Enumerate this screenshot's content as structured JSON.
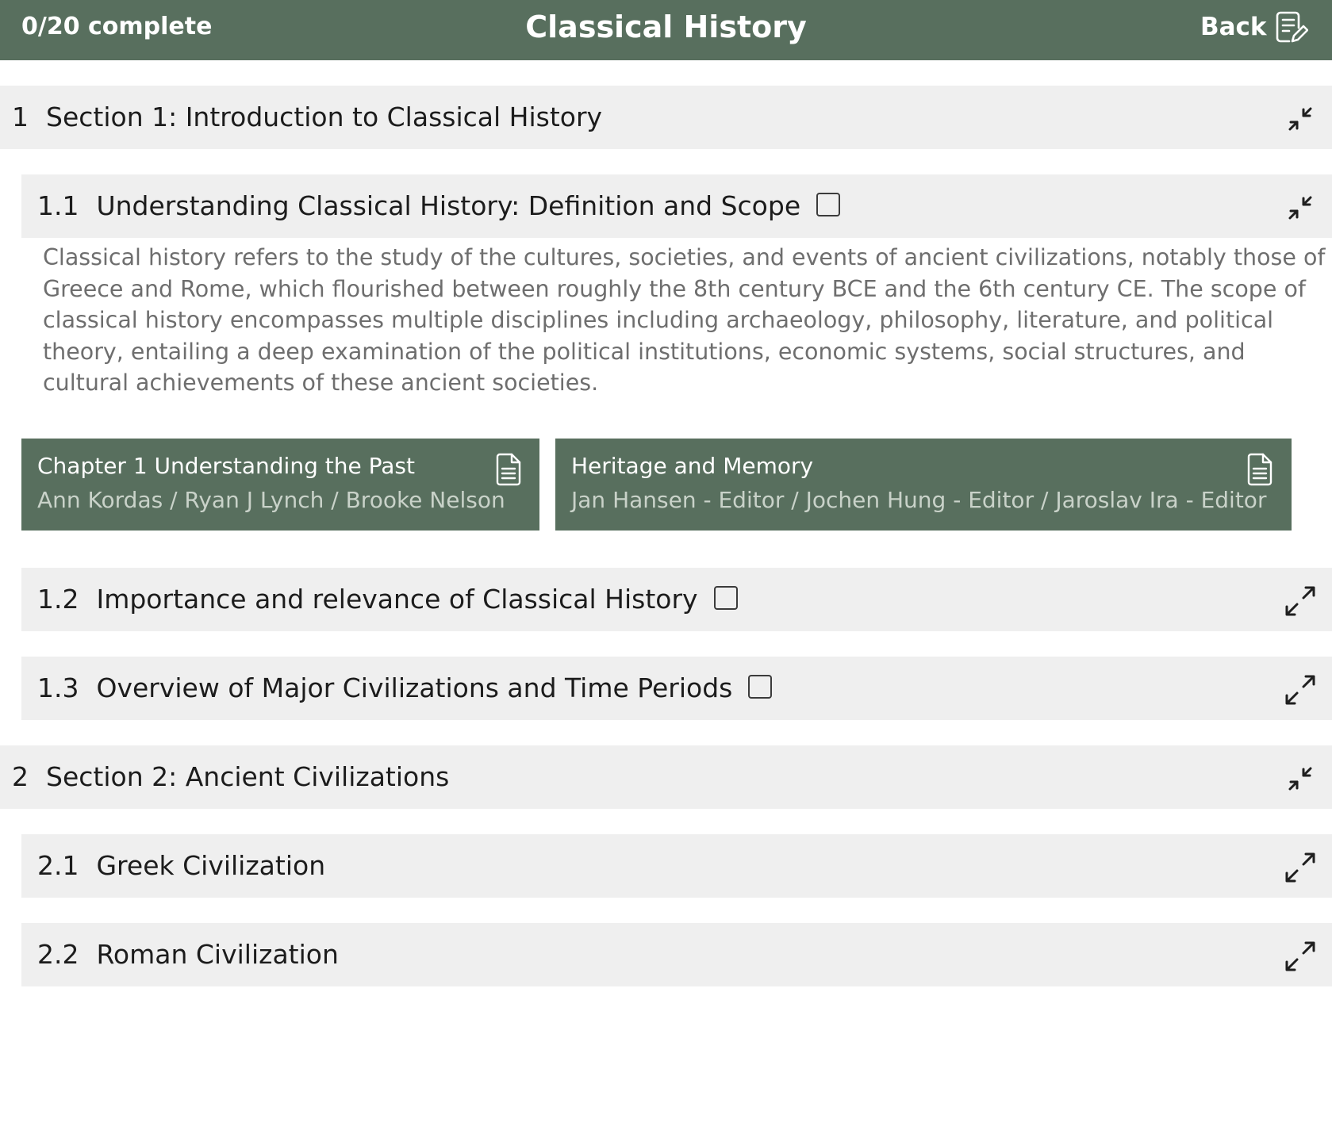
{
  "header": {
    "progress": "0/20 complete",
    "title": "Classical History",
    "back_label": "Back",
    "icon": "notes-edit-icon"
  },
  "colors": {
    "brand": "#586f5e",
    "row_bg": "#efefef",
    "description_text": "#6e6e6e"
  },
  "sections": [
    {
      "number": "1",
      "title": "Section 1: Introduction to Classical History",
      "expanded": true,
      "toggle_icon": "collapse-icon",
      "subsections": [
        {
          "number": "1.1",
          "title": "Understanding Classical History: Definition and Scope",
          "checked": false,
          "expanded": true,
          "toggle_icon": "collapse-icon",
          "description": "Classical history refers to the study of the cultures, societies, and events of ancient civilizations, notably those of Greece and Rome, which flourished between roughly the 8th century BCE and the 6th century CE. The scope of classical history encompasses multiple disciplines including archaeology, philosophy, literature, and political theory, entailing a deep examination of the political institutions, economic systems, social structures, and cultural achievements of these ancient societies.",
          "resources": [
            {
              "title": "Chapter 1 Understanding the Past",
              "authors": "Ann Kordas / Ryan J Lynch / Brooke Nelson",
              "icon": "document-icon"
            },
            {
              "title": "Heritage and Memory",
              "authors": "Jan Hansen - Editor / Jochen Hung - Editor / Jaroslav Ira - Editor",
              "icon": "document-icon"
            }
          ]
        },
        {
          "number": "1.2",
          "title": "Importance and relevance of Classical History",
          "checked": false,
          "expanded": false,
          "toggle_icon": "expand-icon"
        },
        {
          "number": "1.3",
          "title": "Overview of Major Civilizations and Time Periods",
          "checked": false,
          "expanded": false,
          "toggle_icon": "expand-icon"
        }
      ]
    },
    {
      "number": "2",
      "title": "Section 2: Ancient Civilizations",
      "expanded": true,
      "toggle_icon": "collapse-icon",
      "subsections": [
        {
          "number": "2.1",
          "title": "Greek Civilization",
          "expanded": false,
          "toggle_icon": "expand-icon"
        },
        {
          "number": "2.2",
          "title": "Roman Civilization",
          "expanded": false,
          "toggle_icon": "expand-icon"
        }
      ]
    }
  ]
}
